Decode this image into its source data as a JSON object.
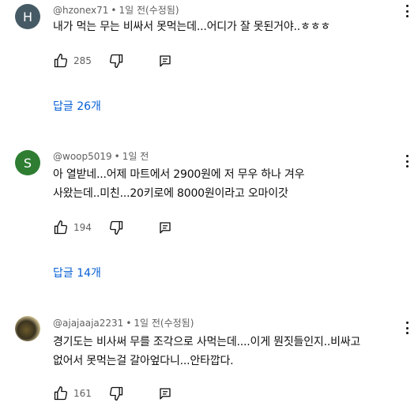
{
  "comments": [
    {
      "avatar_letter": "H",
      "avatar_color": "#455a64",
      "author": "@hzonex71",
      "time": "1일 전(수정됨)",
      "text_lines": [
        "내가 먹는 무는 비싸서 못먹는데...어디가 잘 못된거야..ㅎㅎㅎ"
      ],
      "likes": "285",
      "replies_label": "답글 26개"
    },
    {
      "avatar_letter": "S",
      "avatar_color": "#2e7d32",
      "author": "@woop5019",
      "time": "1일 전",
      "text_lines": [
        "아 열받네...어제 마트에서 2900원에 저 무우 하나 겨우",
        "사왔는데..미친...20키로에 8000원이라고 오마이갓"
      ],
      "likes": "194",
      "replies_label": "답글 14개"
    },
    {
      "avatar_letter": "",
      "author": "@ajajaaja2231",
      "time": "1일 전(수정됨)",
      "text_lines": [
        "경기도는 비사써 무를 조각으로 사먹는데....이게 뭔짓들인지..비싸고",
        "없어서 못먹는걸 갈아엎다니...안타깝다."
      ],
      "likes": "161"
    }
  ],
  "colors": {
    "link": "#065fd4",
    "meta": "#606060",
    "text": "#0f0f0f"
  },
  "icons": {
    "like": "thumbs-up-icon",
    "dislike": "thumbs-down-icon",
    "reply": "reply-icon",
    "more": "more-vert-icon"
  }
}
